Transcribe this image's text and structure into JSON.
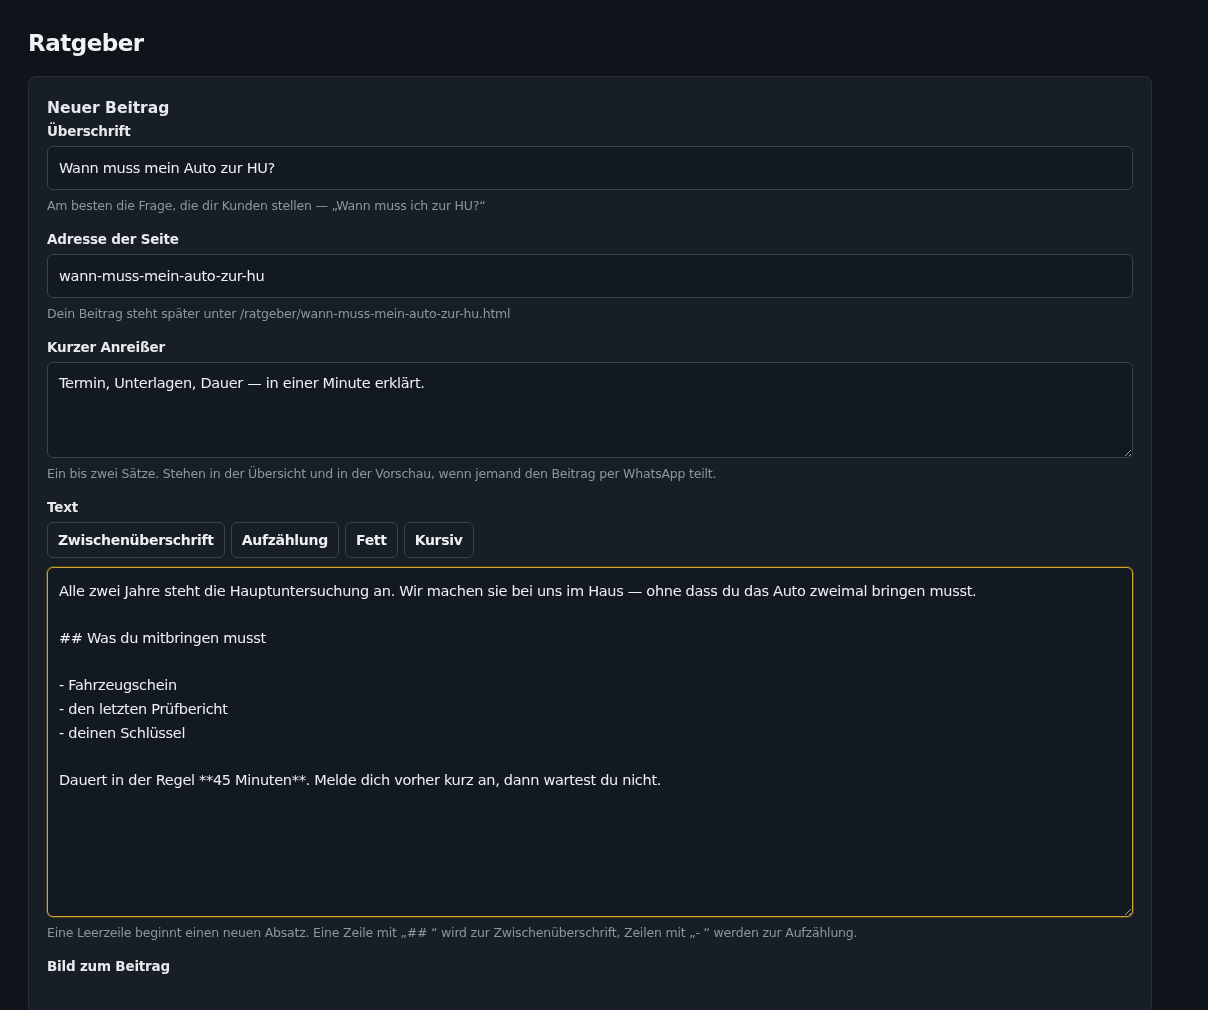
{
  "page": {
    "title": "Ratgeber"
  },
  "form": {
    "title": "Neuer Beitrag",
    "fields": [
      {
        "kind": "input",
        "label": "Überschrift",
        "value": "Wann muss mein Auto zur HU?",
        "hint": "Am besten die Frage, die dir Kunden stellen — „Wann muss ich zur HU?“",
        "focused": false
      },
      {
        "kind": "input",
        "label": "Adresse der Seite",
        "value": "wann-muss-mein-auto-zur-hu",
        "hint": "Dein Beitrag steht später unter /ratgeber/wann-muss-mein-auto-zur-hu.html",
        "focused": false
      },
      {
        "kind": "textarea",
        "label": "Kurzer Anreißer",
        "value": "Termin, Unterlagen, Dauer — in einer Minute erklärt.",
        "hint": "Ein bis zwei Sätze. Stehen in der Übersicht und in der Vorschau, wenn jemand den Beitrag per WhatsApp teilt.",
        "focused": false
      },
      {
        "kind": "editor",
        "label": "Text",
        "toolbar": [
          "Zwischenüberschrift",
          "Aufzählung",
          "Fett",
          "Kursiv"
        ],
        "value": "Alle zwei Jahre steht die Hauptuntersuchung an. Wir machen sie bei uns im Haus — ohne dass du das Auto zweimal bringen musst.\n\n## Was du mitbringen musst\n\n- Fahrzeugschein\n- den letzten Prüfbericht\n- deinen Schlüssel\n\nDauert in der Regel **45 Minuten**. Melde dich vorher kurz an, dann wartest du nicht.",
        "hint": "Eine Leerzeile beginnt einen neuen Absatz. Eine Zeile mit „## “ wird zur Zwischenüberschrift, Zeilen mit „- “ werden zur Aufzählung.",
        "focused": true
      },
      {
        "kind": "label",
        "label": "Bild zum Beitrag"
      }
    ]
  }
}
